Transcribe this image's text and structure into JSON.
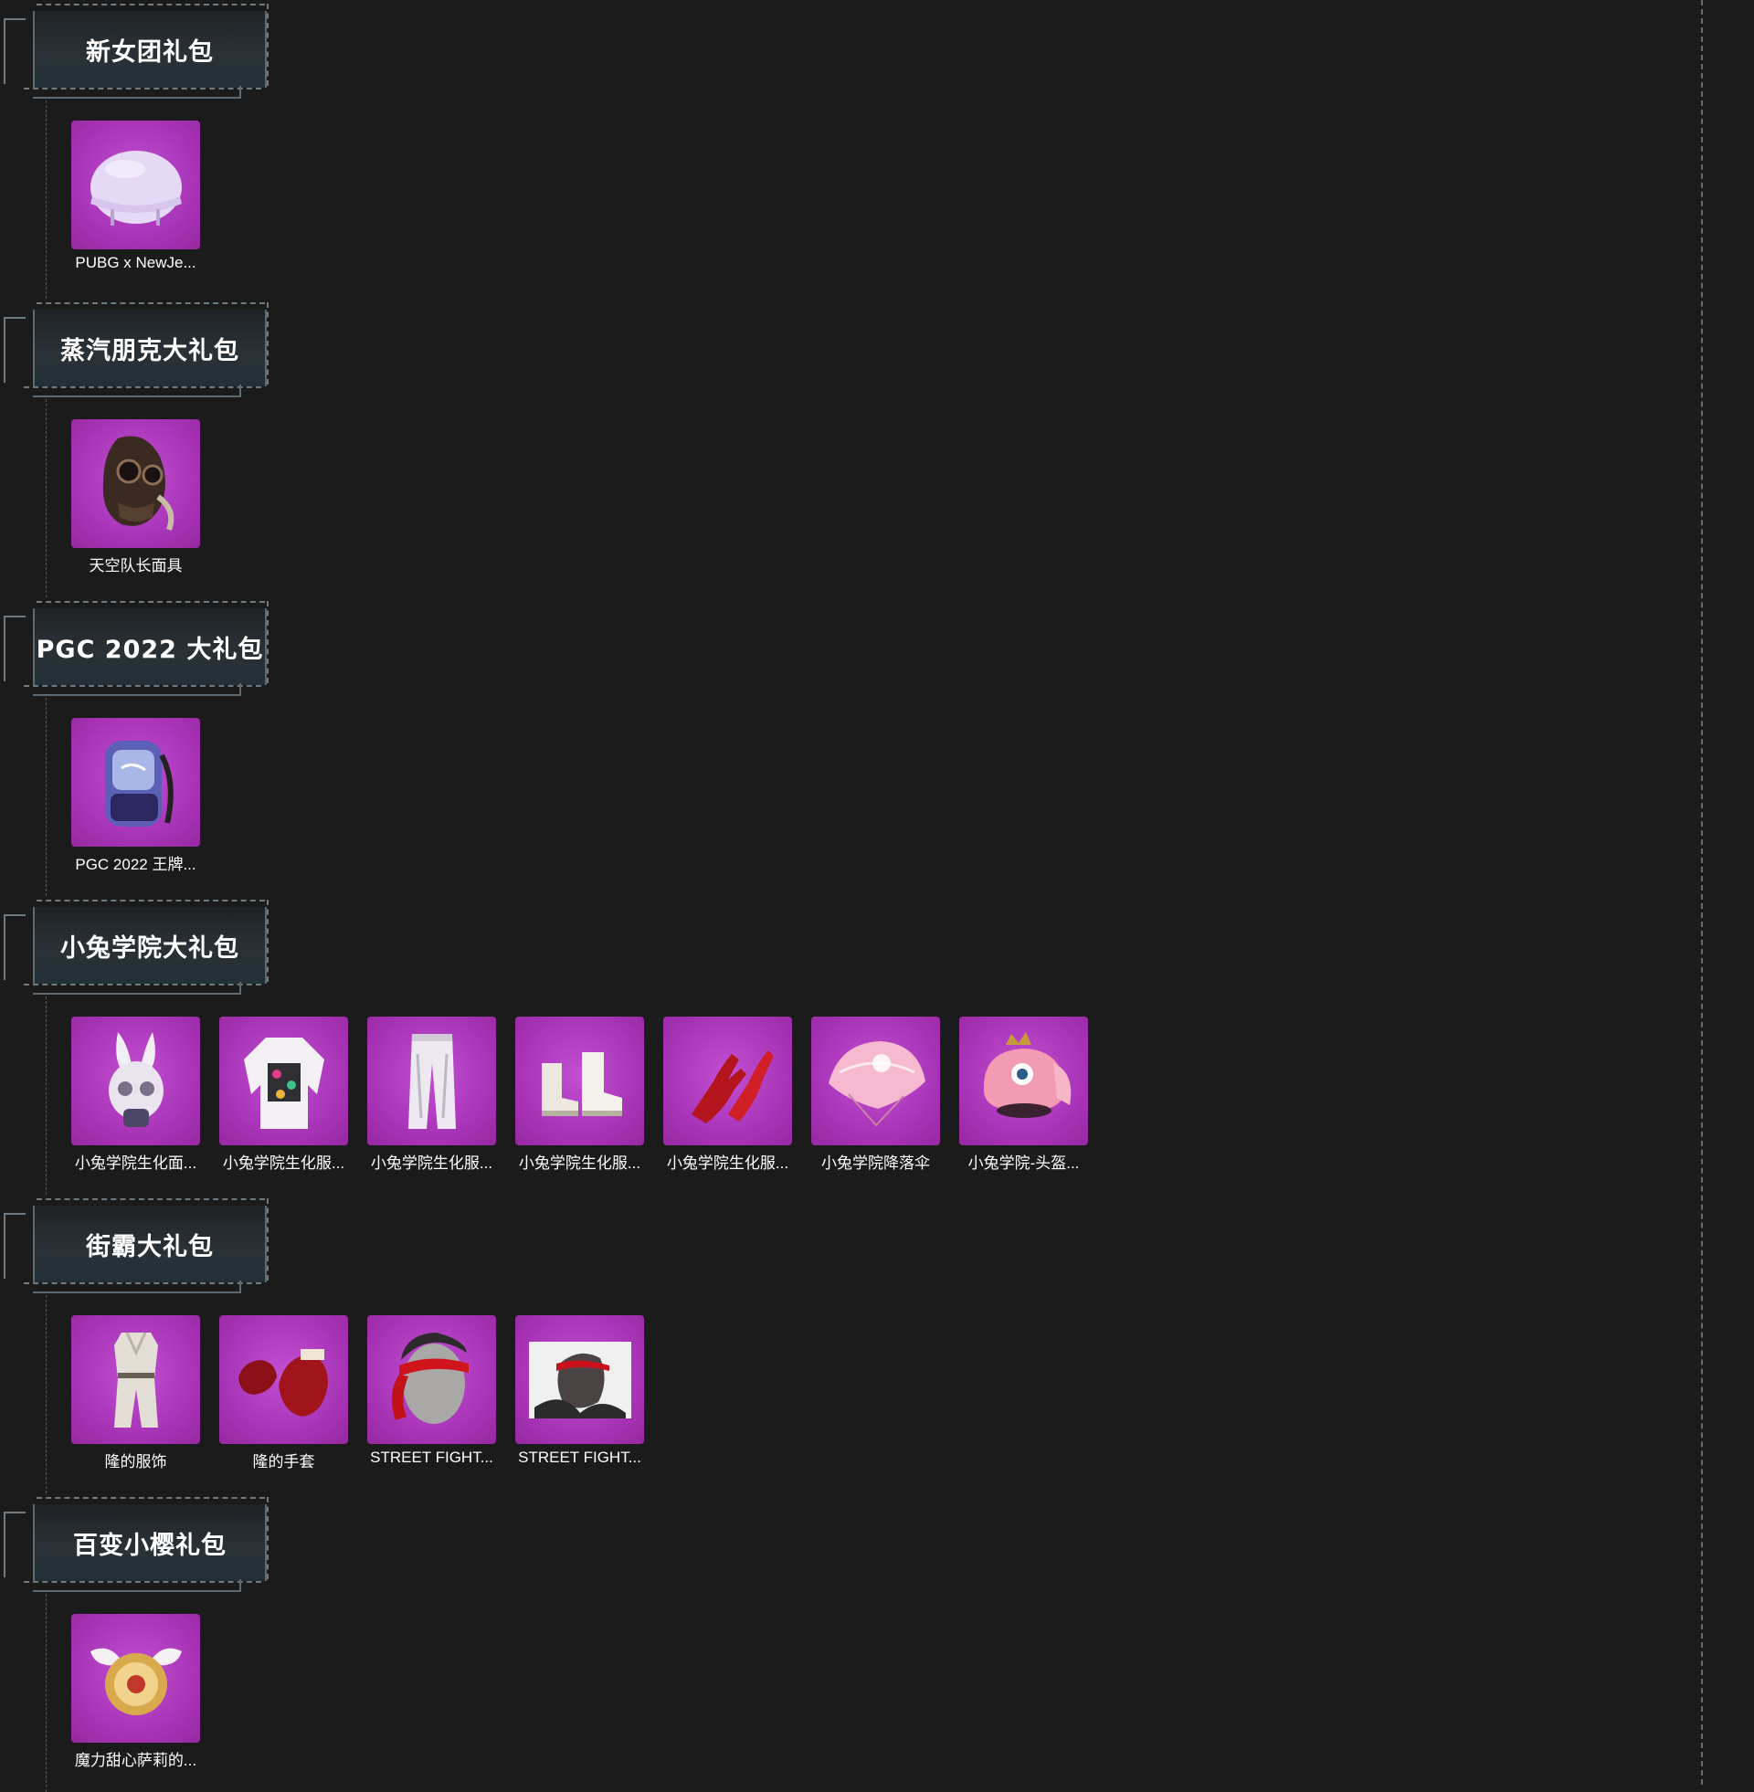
{
  "packs": [
    {
      "title": "新女团礼包",
      "items": [
        {
          "label": "PUBG x NewJe...",
          "icon": "helmet-icon"
        }
      ]
    },
    {
      "title": "蒸汽朋克大礼包",
      "items": [
        {
          "label": "天空队长面具",
          "icon": "gas-mask-icon"
        }
      ]
    },
    {
      "title": "PGC 2022 大礼包",
      "items": [
        {
          "label": "PGC 2022 王牌...",
          "icon": "backpack-icon"
        }
      ]
    },
    {
      "title": "小兔学院大礼包",
      "items": [
        {
          "label": "小兔学院生化面...",
          "icon": "bunny-mask-icon"
        },
        {
          "label": "小兔学院生化服...",
          "icon": "jacket-icon"
        },
        {
          "label": "小兔学院生化服...",
          "icon": "pants-icon"
        },
        {
          "label": "小兔学院生化服...",
          "icon": "boots-icon"
        },
        {
          "label": "小兔学院生化服...",
          "icon": "gloves-icon"
        },
        {
          "label": "小兔学院降落伞",
          "icon": "parachute-icon"
        },
        {
          "label": "小兔学院-头盔...",
          "icon": "bunny-helmet-icon"
        }
      ]
    },
    {
      "title": "街霸大礼包",
      "items": [
        {
          "label": "隆的服饰",
          "icon": "gi-outfit-icon"
        },
        {
          "label": "隆的手套",
          "icon": "fight-gloves-icon"
        },
        {
          "label": "STREET FIGHT...",
          "icon": "headband-head-icon"
        },
        {
          "label": "STREET FIGHT...",
          "icon": "fighter-portrait-icon"
        }
      ]
    },
    {
      "title": "百变小樱礼包",
      "items": [
        {
          "label": "魔力甜心萨莉的...",
          "icon": "winged-shield-icon"
        }
      ]
    }
  ],
  "colors": {
    "background": "#1b1b1c",
    "tile": "#a935b9",
    "frame": "#2a3136"
  }
}
